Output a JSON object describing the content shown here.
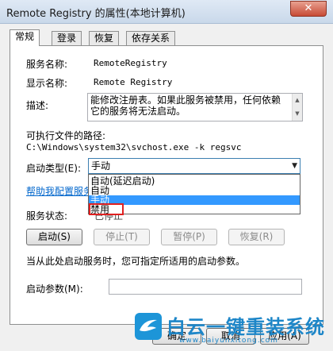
{
  "window": {
    "title": "Remote Registry 的属性(本地计算机)",
    "close_glyph": "✕"
  },
  "tabs": [
    {
      "label": "常规",
      "active": true
    },
    {
      "label": "登录",
      "active": false
    },
    {
      "label": "恢复",
      "active": false
    },
    {
      "label": "依存关系",
      "active": false
    }
  ],
  "general": {
    "service_name_label": "服务名称:",
    "service_name_value": "RemoteRegistry",
    "display_name_label": "显示名称:",
    "display_name_value": "Remote Registry",
    "description_label": "描述:",
    "description_value": "能修改注册表。如果此服务被禁用，任何依赖它的服务将无法启动。",
    "exe_path_label": "可执行文件的路径:",
    "exe_path_value": "C:\\Windows\\system32\\svchost.exe -k regsvc",
    "startup_type_label": "启动类型(E):",
    "startup_type_value": "手动",
    "startup_options": [
      "自动(延迟启动)",
      "自动",
      "手动",
      "禁用"
    ],
    "startup_selected_index": 2,
    "help_link": "帮助我配置服务启",
    "status_label": "服务状态:",
    "status_value": "已停止",
    "buttons": {
      "start": "启动(S)",
      "stop": "停止(T)",
      "pause": "暂停(P)",
      "resume": "恢复(R)"
    },
    "hint": "当从此处启动服务时，您可指定所适用的启动参数。",
    "param_label": "启动参数(M):",
    "param_value": ""
  },
  "footer": {
    "ok": "确定",
    "cancel": "取消",
    "apply": "应用(A)"
  },
  "watermark": {
    "text": "白云一键重装系统",
    "url": "www.baiyunxitong.com"
  },
  "colors": {
    "selection": "#3399ff",
    "highlight_box": "#e02020",
    "link": "#0066cc",
    "watermark": "#1d86c8"
  }
}
